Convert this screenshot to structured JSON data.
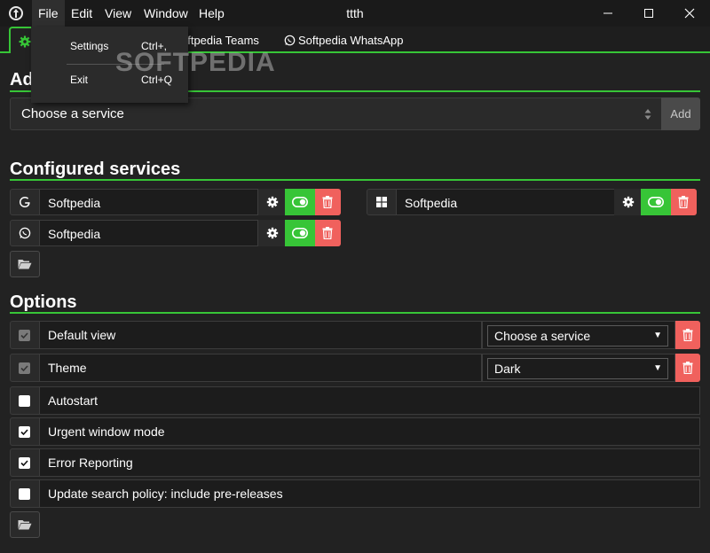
{
  "window": {
    "title": "ttth",
    "menu": [
      "File",
      "Edit",
      "View",
      "Window",
      "Help"
    ]
  },
  "file_menu": {
    "items": [
      {
        "label": "Settings",
        "shortcut": "Ctrl+,"
      },
      {
        "label": "Exit",
        "shortcut": "Ctrl+Q"
      }
    ]
  },
  "tabs": [
    {
      "label": "oftpedia Teams",
      "icon": "teams-icon"
    },
    {
      "label": "Softpedia WhatsApp",
      "icon": "whatsapp-icon"
    }
  ],
  "watermark": "SOFTPEDIA",
  "add_section": {
    "title": "Ad",
    "select_value": "Choose a service",
    "add_label": "Add"
  },
  "configured": {
    "title": "Configured services",
    "services": [
      {
        "name": "Softpedia",
        "icon": "google-icon",
        "enabled": true
      },
      {
        "name": "Softpedia",
        "icon": "windows-icon",
        "enabled": true
      },
      {
        "name": "Softpedia",
        "icon": "whatsapp-icon",
        "enabled": true
      }
    ]
  },
  "options": {
    "title": "Options",
    "rows": [
      {
        "label": "Default view",
        "checked": true,
        "disabled": true,
        "select": "Choose a service"
      },
      {
        "label": "Theme",
        "checked": true,
        "disabled": true,
        "select": "Dark"
      },
      {
        "label": "Autostart",
        "checked": false
      },
      {
        "label": "Urgent window mode",
        "checked": true
      },
      {
        "label": "Error Reporting",
        "checked": true
      },
      {
        "label": "Update search policy: include pre-releases",
        "checked": false
      }
    ]
  },
  "colors": {
    "accent": "#37c537",
    "danger": "#f0615d",
    "background": "#222222"
  }
}
